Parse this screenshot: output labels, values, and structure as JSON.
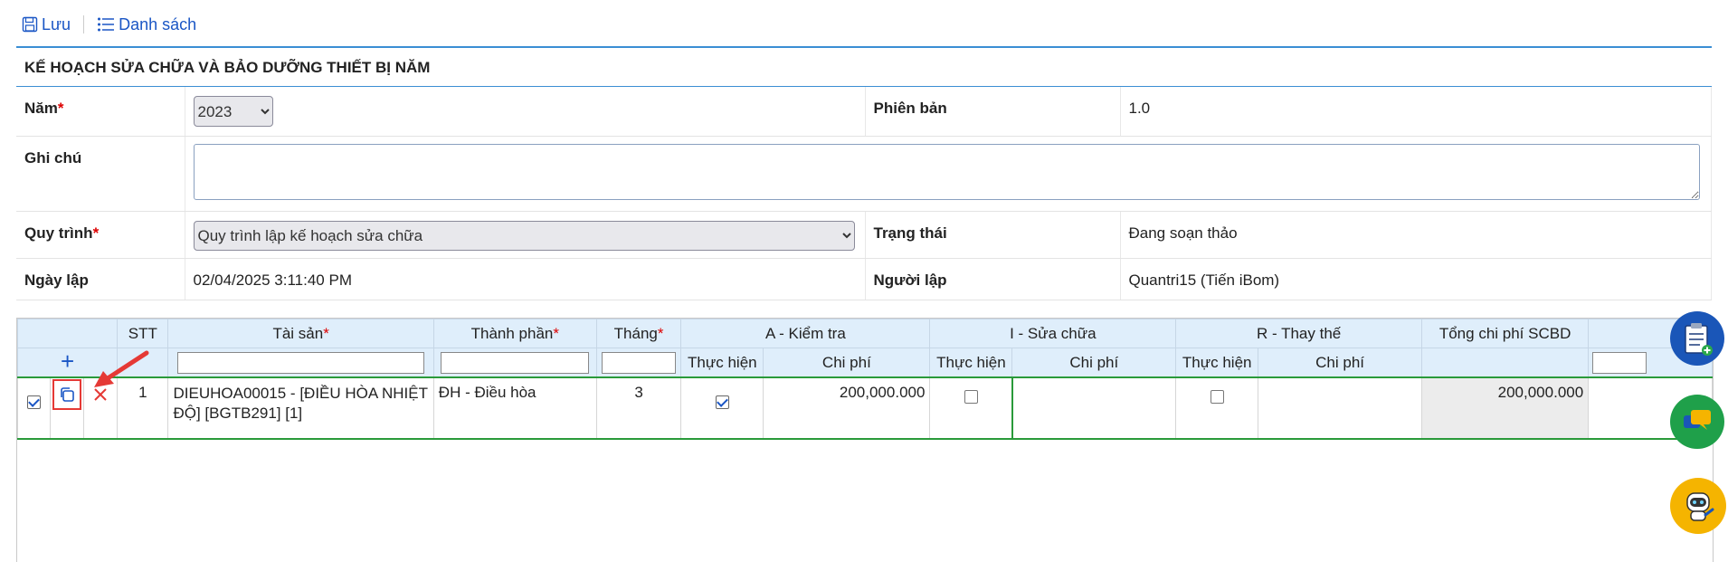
{
  "toolbar": {
    "save_label": "Lưu",
    "list_label": "Danh sách"
  },
  "form": {
    "title": "KẾ HOẠCH SỬA CHỮA VÀ BẢO DƯỠNG THIẾT BỊ NĂM",
    "year_label": "Năm",
    "year_value": "2023",
    "version_label": "Phiên bản",
    "version_value": "1.0",
    "note_label": "Ghi chú",
    "note_value": "",
    "process_label": "Quy trình",
    "process_value": "Quy trình lập kế hoạch sửa chữa",
    "status_label": "Trạng thái",
    "status_value": "Đang soạn thảo",
    "created_label": "Ngày lập",
    "created_value": "02/04/2025 3:11:40 PM",
    "creator_label": "Người lập",
    "creator_value": "Quantri15 (Tiến iBom)",
    "required_mark": "*"
  },
  "grid": {
    "headers": {
      "stt": "STT",
      "asset": "Tài sản",
      "component": "Thành phần",
      "month": "Tháng",
      "check_group": "A - Kiểm tra",
      "repair_group": "I - Sửa chữa",
      "replace_group": "R - Thay thế",
      "total": "Tổng chi phí SCBD",
      "done": "Thực hiện",
      "cost": "Chi phí"
    },
    "add_symbol": "+",
    "rows": [
      {
        "selected": true,
        "stt": "1",
        "asset": "DIEUHOA00015 - [ĐIỀU HÒA NHIỆT ĐỘ] [BGTB291] [1]",
        "component": "ĐH - Điều hòa",
        "month": "3",
        "check_done": true,
        "check_cost": "200,000.000",
        "repair_done": false,
        "repair_cost": "",
        "replace_done": false,
        "replace_cost": "",
        "total": "200,000.000"
      }
    ]
  },
  "colors": {
    "accent": "#1a56c5",
    "header_bg": "#dfeefb",
    "row_border": "#2a9a3a",
    "annotation": "#e53935"
  }
}
